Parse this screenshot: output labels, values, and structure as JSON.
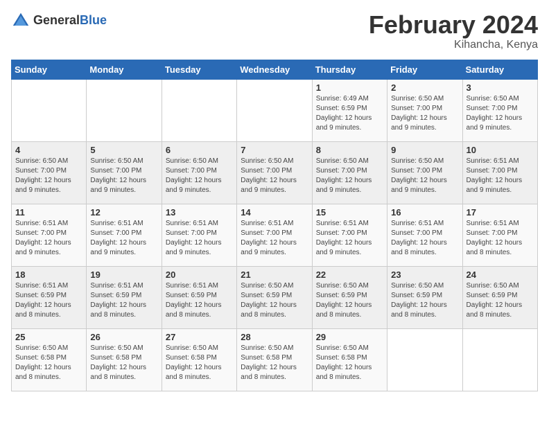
{
  "header": {
    "logo_general": "General",
    "logo_blue": "Blue",
    "month": "February 2024",
    "location": "Kihancha, Kenya"
  },
  "weekdays": [
    "Sunday",
    "Monday",
    "Tuesday",
    "Wednesday",
    "Thursday",
    "Friday",
    "Saturday"
  ],
  "weeks": [
    [
      {
        "day": "",
        "info": ""
      },
      {
        "day": "",
        "info": ""
      },
      {
        "day": "",
        "info": ""
      },
      {
        "day": "",
        "info": ""
      },
      {
        "day": "1",
        "info": "Sunrise: 6:49 AM\nSunset: 6:59 PM\nDaylight: 12 hours\nand 9 minutes."
      },
      {
        "day": "2",
        "info": "Sunrise: 6:50 AM\nSunset: 7:00 PM\nDaylight: 12 hours\nand 9 minutes."
      },
      {
        "day": "3",
        "info": "Sunrise: 6:50 AM\nSunset: 7:00 PM\nDaylight: 12 hours\nand 9 minutes."
      }
    ],
    [
      {
        "day": "4",
        "info": "Sunrise: 6:50 AM\nSunset: 7:00 PM\nDaylight: 12 hours\nand 9 minutes."
      },
      {
        "day": "5",
        "info": "Sunrise: 6:50 AM\nSunset: 7:00 PM\nDaylight: 12 hours\nand 9 minutes."
      },
      {
        "day": "6",
        "info": "Sunrise: 6:50 AM\nSunset: 7:00 PM\nDaylight: 12 hours\nand 9 minutes."
      },
      {
        "day": "7",
        "info": "Sunrise: 6:50 AM\nSunset: 7:00 PM\nDaylight: 12 hours\nand 9 minutes."
      },
      {
        "day": "8",
        "info": "Sunrise: 6:50 AM\nSunset: 7:00 PM\nDaylight: 12 hours\nand 9 minutes."
      },
      {
        "day": "9",
        "info": "Sunrise: 6:50 AM\nSunset: 7:00 PM\nDaylight: 12 hours\nand 9 minutes."
      },
      {
        "day": "10",
        "info": "Sunrise: 6:51 AM\nSunset: 7:00 PM\nDaylight: 12 hours\nand 9 minutes."
      }
    ],
    [
      {
        "day": "11",
        "info": "Sunrise: 6:51 AM\nSunset: 7:00 PM\nDaylight: 12 hours\nand 9 minutes."
      },
      {
        "day": "12",
        "info": "Sunrise: 6:51 AM\nSunset: 7:00 PM\nDaylight: 12 hours\nand 9 minutes."
      },
      {
        "day": "13",
        "info": "Sunrise: 6:51 AM\nSunset: 7:00 PM\nDaylight: 12 hours\nand 9 minutes."
      },
      {
        "day": "14",
        "info": "Sunrise: 6:51 AM\nSunset: 7:00 PM\nDaylight: 12 hours\nand 9 minutes."
      },
      {
        "day": "15",
        "info": "Sunrise: 6:51 AM\nSunset: 7:00 PM\nDaylight: 12 hours\nand 9 minutes."
      },
      {
        "day": "16",
        "info": "Sunrise: 6:51 AM\nSunset: 7:00 PM\nDaylight: 12 hours\nand 8 minutes."
      },
      {
        "day": "17",
        "info": "Sunrise: 6:51 AM\nSunset: 7:00 PM\nDaylight: 12 hours\nand 8 minutes."
      }
    ],
    [
      {
        "day": "18",
        "info": "Sunrise: 6:51 AM\nSunset: 6:59 PM\nDaylight: 12 hours\nand 8 minutes."
      },
      {
        "day": "19",
        "info": "Sunrise: 6:51 AM\nSunset: 6:59 PM\nDaylight: 12 hours\nand 8 minutes."
      },
      {
        "day": "20",
        "info": "Sunrise: 6:51 AM\nSunset: 6:59 PM\nDaylight: 12 hours\nand 8 minutes."
      },
      {
        "day": "21",
        "info": "Sunrise: 6:50 AM\nSunset: 6:59 PM\nDaylight: 12 hours\nand 8 minutes."
      },
      {
        "day": "22",
        "info": "Sunrise: 6:50 AM\nSunset: 6:59 PM\nDaylight: 12 hours\nand 8 minutes."
      },
      {
        "day": "23",
        "info": "Sunrise: 6:50 AM\nSunset: 6:59 PM\nDaylight: 12 hours\nand 8 minutes."
      },
      {
        "day": "24",
        "info": "Sunrise: 6:50 AM\nSunset: 6:59 PM\nDaylight: 12 hours\nand 8 minutes."
      }
    ],
    [
      {
        "day": "25",
        "info": "Sunrise: 6:50 AM\nSunset: 6:58 PM\nDaylight: 12 hours\nand 8 minutes."
      },
      {
        "day": "26",
        "info": "Sunrise: 6:50 AM\nSunset: 6:58 PM\nDaylight: 12 hours\nand 8 minutes."
      },
      {
        "day": "27",
        "info": "Sunrise: 6:50 AM\nSunset: 6:58 PM\nDaylight: 12 hours\nand 8 minutes."
      },
      {
        "day": "28",
        "info": "Sunrise: 6:50 AM\nSunset: 6:58 PM\nDaylight: 12 hours\nand 8 minutes."
      },
      {
        "day": "29",
        "info": "Sunrise: 6:50 AM\nSunset: 6:58 PM\nDaylight: 12 hours\nand 8 minutes."
      },
      {
        "day": "",
        "info": ""
      },
      {
        "day": "",
        "info": ""
      }
    ]
  ]
}
